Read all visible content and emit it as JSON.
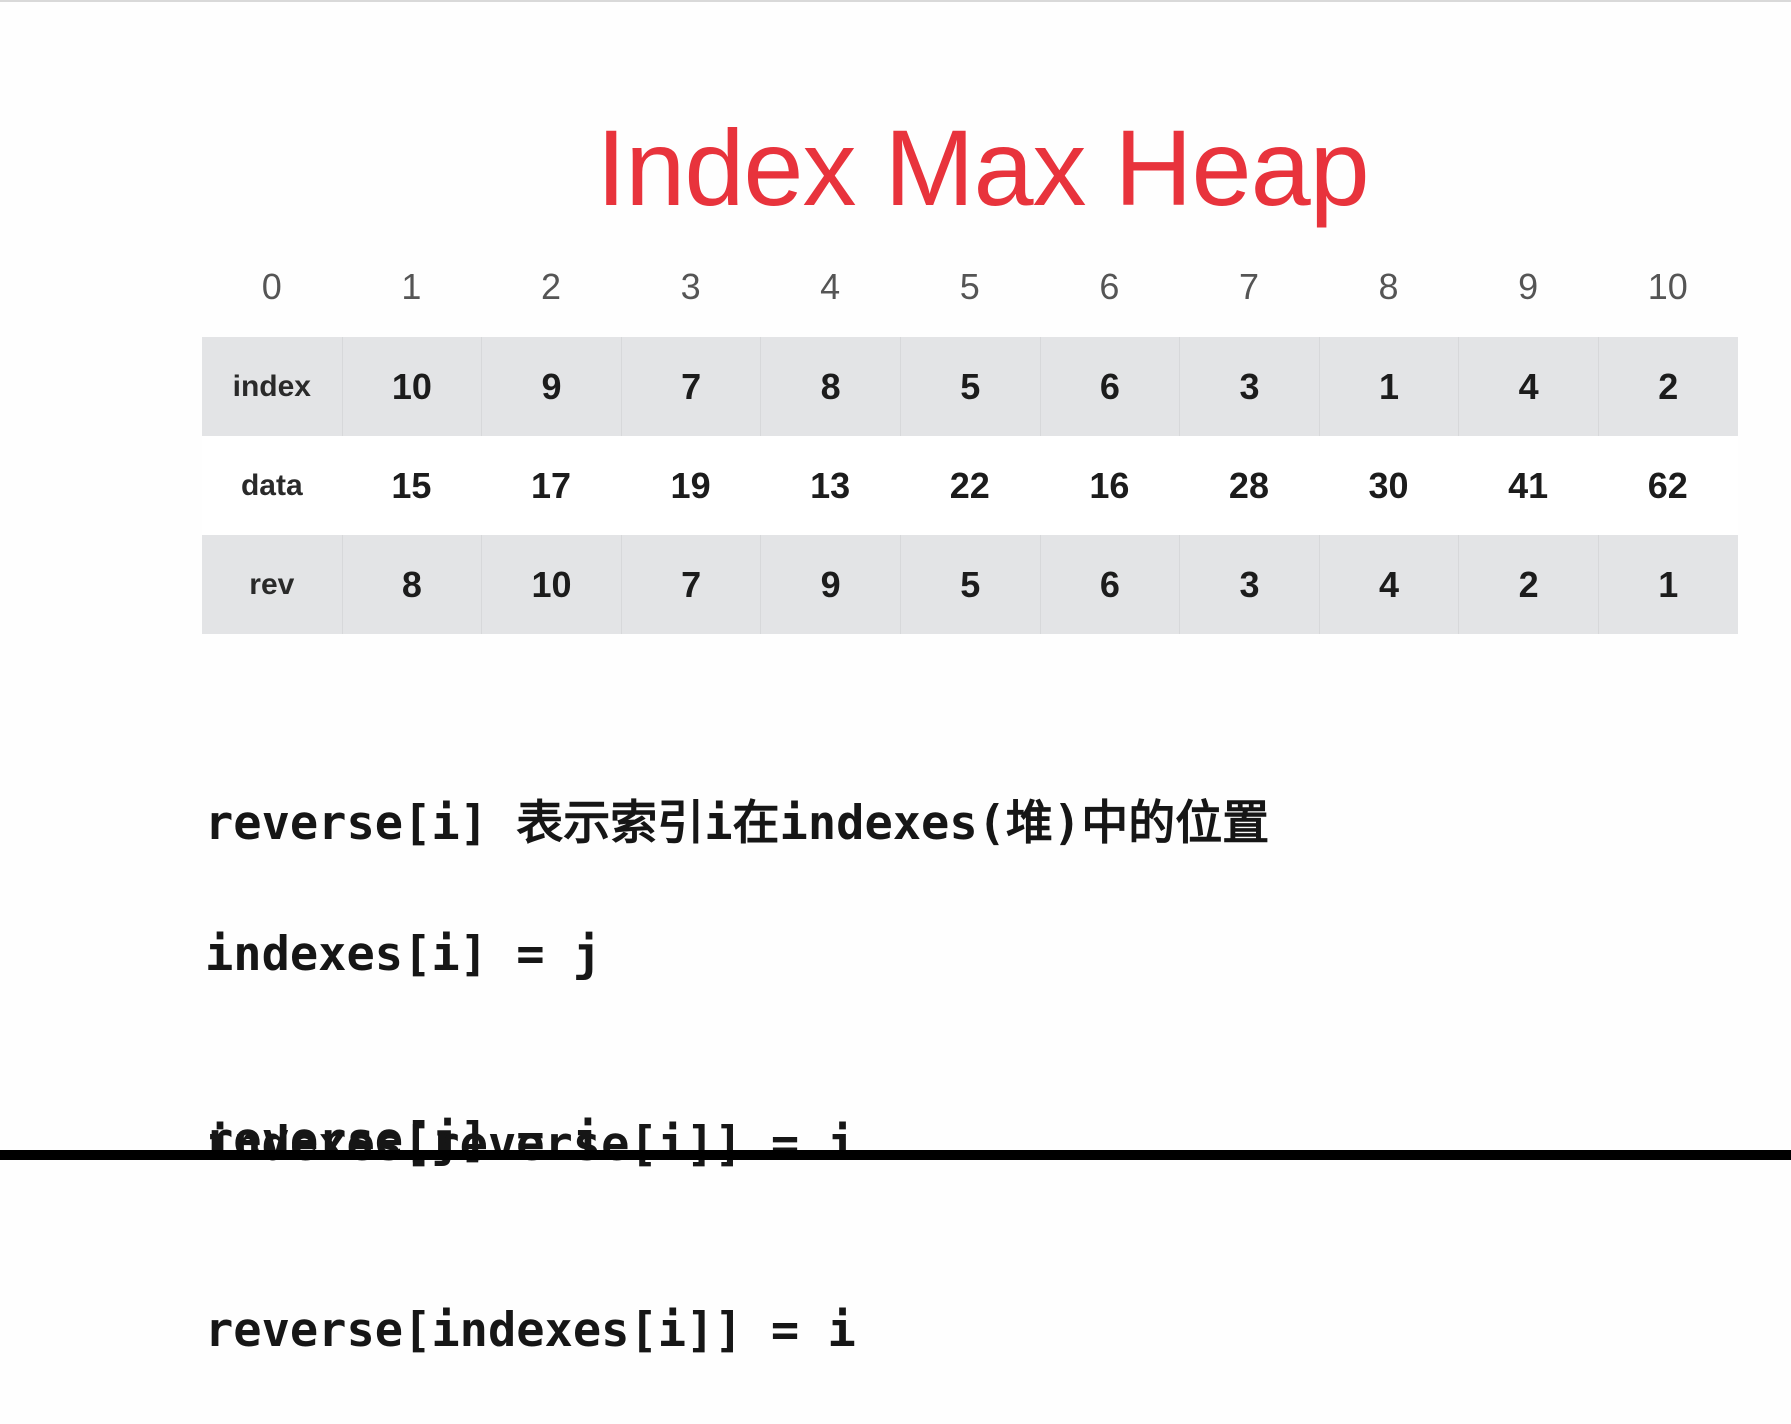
{
  "title": "Index Max Heap",
  "positions": [
    "0",
    "1",
    "2",
    "3",
    "4",
    "5",
    "6",
    "7",
    "8",
    "9",
    "10"
  ],
  "table": {
    "rows": [
      {
        "label": "index",
        "values": [
          "10",
          "9",
          "7",
          "8",
          "5",
          "6",
          "3",
          "1",
          "4",
          "2"
        ]
      },
      {
        "label": "data",
        "values": [
          "15",
          "17",
          "19",
          "13",
          "22",
          "16",
          "28",
          "30",
          "41",
          "62"
        ]
      },
      {
        "label": "rev",
        "values": [
          "8",
          "10",
          "7",
          "9",
          "5",
          "6",
          "3",
          "4",
          "2",
          "1"
        ]
      }
    ]
  },
  "notes": {
    "description": "reverse[i] 表示索引i在indexes(堆)中的位置",
    "pair1": [
      "indexes[i] = j",
      "reverse[j] = i"
    ],
    "pair2": [
      "indexes[reverse[i]] = i",
      "reverse[indexes[i]] = i"
    ]
  },
  "colors": {
    "title": "#e8333c",
    "row_shade": "#e3e4e6",
    "text": "#1c1c1c"
  }
}
